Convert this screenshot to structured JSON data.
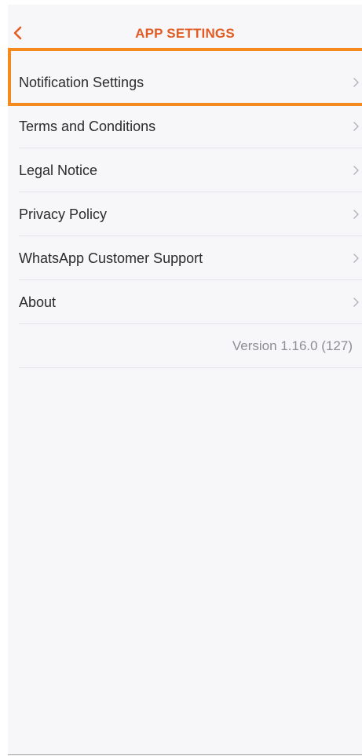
{
  "header": {
    "title": "APP SETTINGS",
    "back_icon": "chevron-left-icon"
  },
  "menu": {
    "items": [
      {
        "label": "Notification Settings",
        "highlighted": true
      },
      {
        "label": "Terms and Conditions"
      },
      {
        "label": "Legal Notice"
      },
      {
        "label": "Privacy Policy"
      },
      {
        "label": "WhatsApp Customer Support"
      },
      {
        "label": "About"
      }
    ],
    "chevron_icon": "chevron-right-icon"
  },
  "footer": {
    "version": "Version 1.16.0 (127)"
  },
  "colors": {
    "accent": "#e25b23",
    "highlight_border": "#f58a1f",
    "background": "#f7f6f9",
    "text": "#2b2b2b",
    "muted": "#8e8e93"
  }
}
